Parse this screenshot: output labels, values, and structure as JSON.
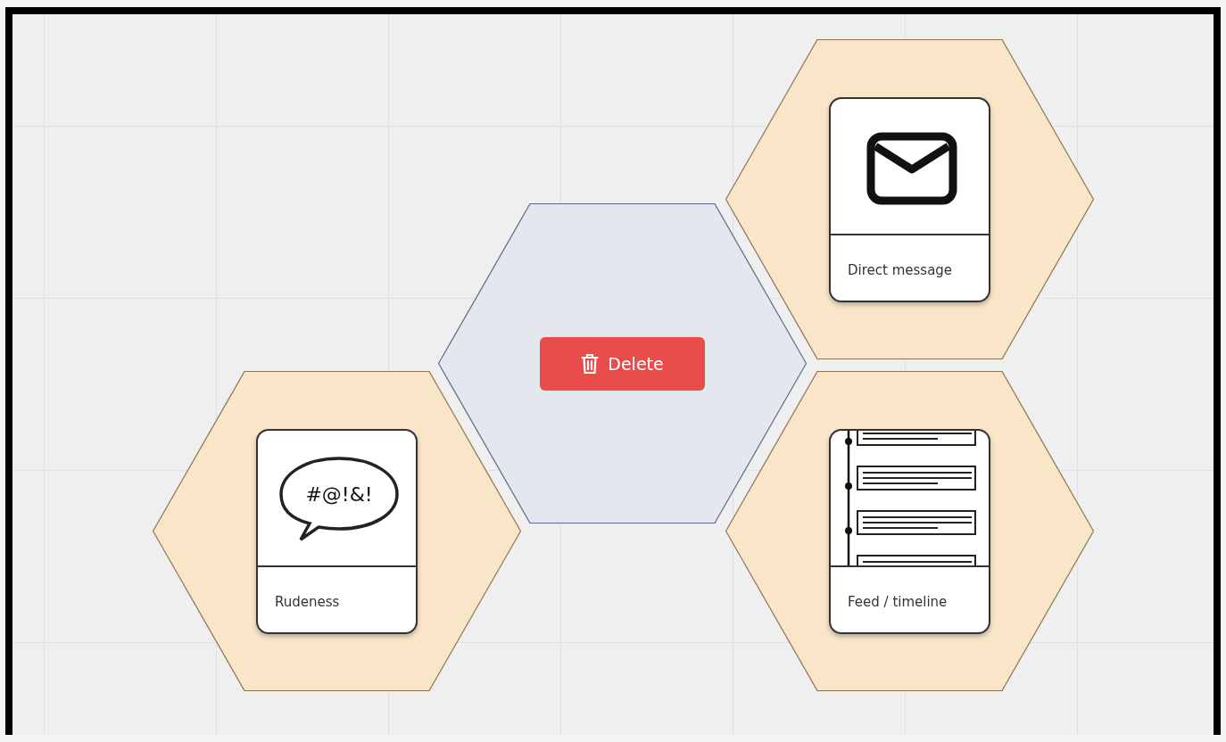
{
  "canvas": {
    "tiles": [
      {
        "kind": "card",
        "selected": false,
        "card": {
          "kind": "message",
          "label": "Direct message"
        }
      },
      {
        "kind": "action",
        "selected": true,
        "button": "Delete"
      },
      {
        "kind": "card",
        "selected": false,
        "card": {
          "kind": "speech",
          "symbols": "#@!&!",
          "label": "Rudeness"
        }
      },
      {
        "kind": "card",
        "selected": false,
        "card": {
          "kind": "feed",
          "label": "Feed / timeline"
        }
      }
    ]
  }
}
